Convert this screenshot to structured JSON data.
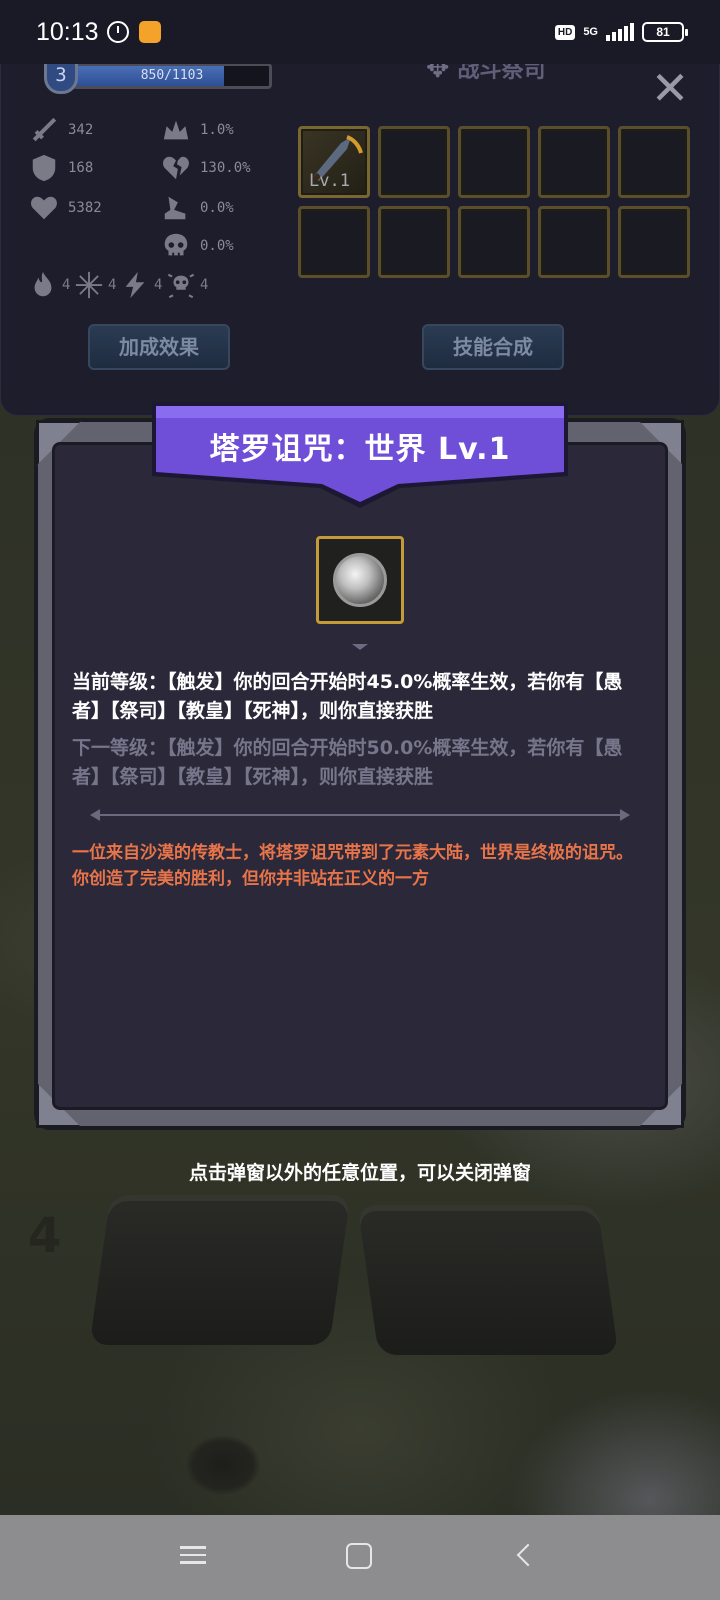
{
  "status_bar": {
    "time": "10:13",
    "hd": "HD",
    "network": "5G",
    "battery": "81"
  },
  "character": {
    "level": "3",
    "xp_text": "850/1103",
    "xp_fraction": 0.77,
    "class_name": "战斗祭司",
    "stats_left": [
      {
        "icon": "sword-icon",
        "value": "342"
      },
      {
        "icon": "shield-icon",
        "value": "168"
      },
      {
        "icon": "heart-icon",
        "value": "5382"
      }
    ],
    "stats_right": [
      {
        "icon": "crown-icon",
        "value": "1.0%"
      },
      {
        "icon": "broken-heart-icon",
        "value": "130.0%"
      },
      {
        "icon": "boot-icon",
        "value": "0.0%"
      },
      {
        "icon": "skull-icon",
        "value": "0.0%"
      }
    ],
    "elements": [
      {
        "icon": "fire-icon",
        "value": "4"
      },
      {
        "icon": "snowflake-icon",
        "value": "4"
      },
      {
        "icon": "lightning-icon",
        "value": "4"
      },
      {
        "icon": "poison-skull-icon",
        "value": "4"
      }
    ],
    "equipped_skill_level": "Lv.1",
    "buttons": {
      "bonus": "加成效果",
      "synthesis": "技能合成"
    }
  },
  "dialog": {
    "title": "塔罗诅咒：世界 Lv.1",
    "current_level": "当前等级：【触发】你的回合开始时45.0%概率生效，若你有【愚者】【祭司】【教皇】【死神】，则你直接获胜",
    "next_level": "下一等级：【触发】你的回合开始时50.0%概率生效，若你有【愚者】【祭司】【教皇】【死神】，则你直接获胜",
    "lore": "一位来自沙漠的传教士，将塔罗诅咒带到了元素大陆，世界是终极的诅咒。你创造了完美的胜利，但你并非站在正义的一方"
  },
  "close_hint": "点击弹窗以外的任意位置，可以关闭弹窗",
  "map": {
    "level_number": "4"
  },
  "colors": {
    "banner": "#6f4ed8",
    "frame_gold": "#c49a3a",
    "lore_text": "#e8744a",
    "xp_fill": "#2d4f96"
  }
}
